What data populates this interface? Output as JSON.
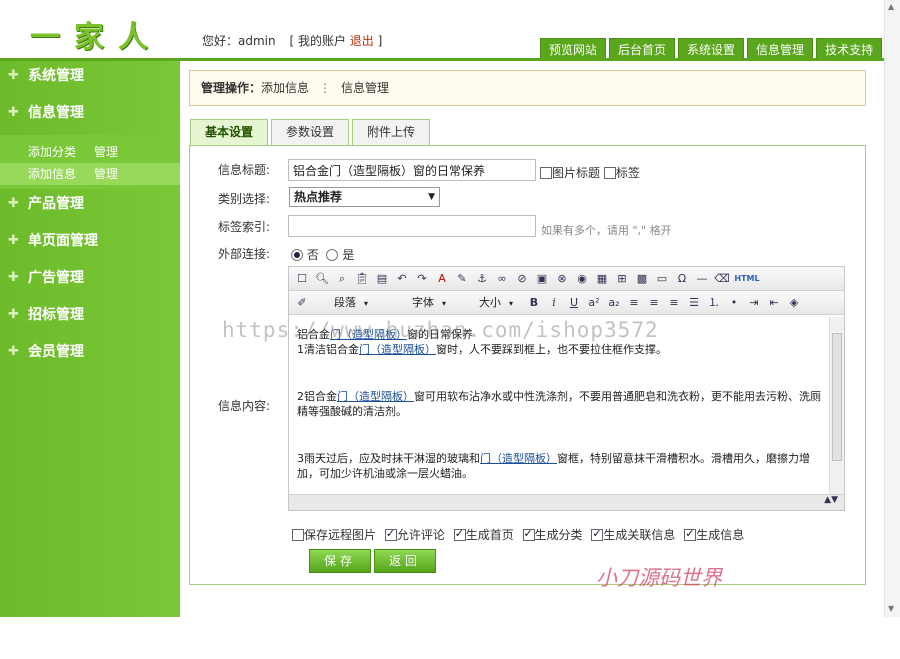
{
  "header": {
    "logo": "一家人",
    "greeting_prefix": "您好：",
    "username": "admin",
    "account_link": "[ 我的账户",
    "logout": "退出",
    "close_bracket": "]",
    "nav": [
      "预览网站",
      "后台首页",
      "系统设置",
      "信息管理",
      "技术支持"
    ]
  },
  "sidebar": {
    "categories": {
      "system": "系统管理",
      "info": "信息管理",
      "product": "产品管理",
      "single_page": "单页面管理",
      "ads": "广告管理",
      "bid": "招标管理",
      "members": "会员管理"
    },
    "info_sub": [
      {
        "name": "添加分类",
        "manage": "管理"
      },
      {
        "name": "添加信息",
        "manage": "管理"
      }
    ]
  },
  "breadcrumb": {
    "label": "管理操作：",
    "current": "添加信息",
    "separator": "⋮",
    "parent": "信息管理"
  },
  "tabs": [
    "基本设置",
    "参数设置",
    "附件上传"
  ],
  "form": {
    "title_label": "信息标题:",
    "title_value": "铝合金门（造型隔板）窗的日常保养",
    "opt_image_title": "图片标题",
    "opt_tag": "标签",
    "category_label": "类别选择:",
    "category_value": "热点推荐",
    "tags_label": "标签索引:",
    "tags_value": "",
    "tags_hint": "如果有多个，请用 \",\" 格开",
    "external_label": "外部连接:",
    "radio_no": "否",
    "radio_yes": "是",
    "content_label": "信息内容:"
  },
  "editor": {
    "paragraph_drop": "段落",
    "font_drop": "字体",
    "size_drop": "大小",
    "bold": "B",
    "italic": "i",
    "underline": "U",
    "sup": "a²",
    "sub": "a₂",
    "html_btn": "HTML",
    "body": {
      "p0_prefix": "铝合金",
      "p0_link": "门（造型隔板）",
      "p0_suffix": "窗的日常保养",
      "p1_prefix": "1清洁铝合金",
      "p1_link": "门（造型隔板）",
      "p1_suffix": "窗时，人不要踩到框上，也不要拉住框作支撑。",
      "p2_prefix": "2铝合金",
      "p2_link": "门（造型隔板）",
      "p2_suffix": "窗可用软布沾净水或中性洗涤剂，不要用普通肥皂和洗衣粉，更不能用去污粉、洗厕精等强酸碱的清洁剂。",
      "p3_prefix": "3雨天过后，应及时抹干淋湿的玻璃和",
      "p3_link": "门（造型隔板）",
      "p3_suffix": "窗框，特别留意抹干滑槽积水。滑槽用久，磨擦力增加，可加少许机油或涂一层火蜡油。"
    }
  },
  "options": [
    {
      "label": "保存远程图片",
      "checked": false
    },
    {
      "label": "允许评论",
      "checked": true
    },
    {
      "label": "生成首页",
      "checked": true
    },
    {
      "label": "生成分类",
      "checked": true
    },
    {
      "label": "生成关联信息",
      "checked": true
    },
    {
      "label": "生成信息",
      "checked": true
    }
  ],
  "buttons": {
    "save": "保存",
    "back": "返回"
  },
  "watermarks": {
    "url": "https://www.huzhan.com/ishop3572",
    "signature": "小刀源码世界"
  },
  "colors": {
    "sidebar_green": "#6dbb2a",
    "nav_green": "#5aa61c",
    "logout_red": "#cc3300",
    "link_blue": "#1b4f9a"
  }
}
